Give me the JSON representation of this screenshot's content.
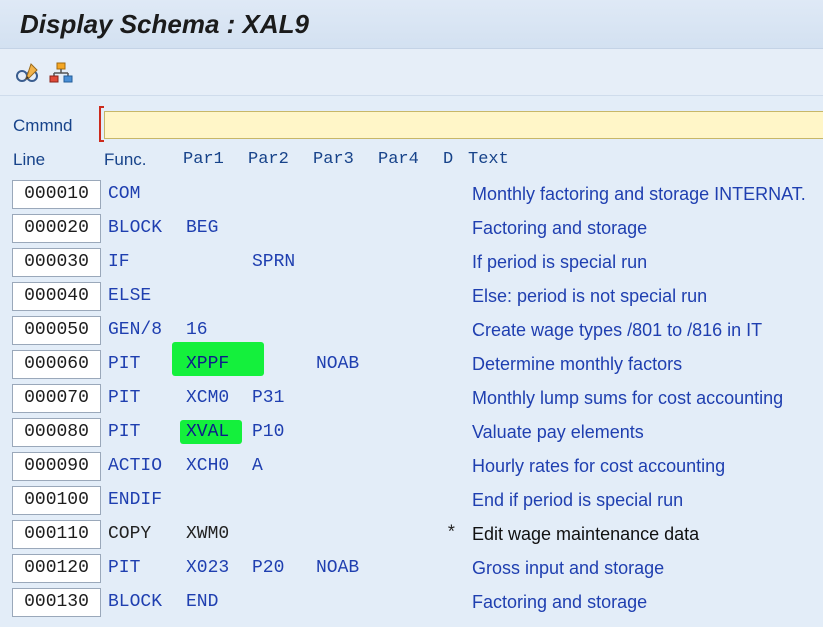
{
  "window": {
    "title": "Display Schema : XAL9"
  },
  "toolbar": {
    "icons": [
      "display-change-icon",
      "hierarchy-icon"
    ]
  },
  "command": {
    "label": "Cmmnd",
    "value": ""
  },
  "columns": {
    "line": "Line",
    "func": "Func.",
    "par1": "Par1",
    "par2": "Par2",
    "par3": "Par3",
    "par4": "Par4",
    "d": "D",
    "text": "Text"
  },
  "highlight_color": "#14f03c",
  "rows": [
    {
      "line": "000010",
      "func": "COM",
      "par1": "",
      "par2": "",
      "par3": "",
      "par4": "",
      "d": "",
      "text": "Monthly factoring and storage INTERNAT."
    },
    {
      "line": "000020",
      "func": "BLOCK",
      "par1": "BEG",
      "par2": "",
      "par3": "",
      "par4": "",
      "d": "",
      "text": "Factoring and storage"
    },
    {
      "line": "000030",
      "func": "IF",
      "par1": "",
      "par2": "SPRN",
      "par3": "",
      "par4": "",
      "d": "",
      "text": "If period is special run"
    },
    {
      "line": "000040",
      "func": "ELSE",
      "par1": "",
      "par2": "",
      "par3": "",
      "par4": "",
      "d": "",
      "text": "Else: period is not special run"
    },
    {
      "line": "000050",
      "func": "GEN/8",
      "par1": "16",
      "par2": "",
      "par3": "",
      "par4": "",
      "d": "",
      "text": "Create wage types /801 to /816 in IT"
    },
    {
      "line": "000060",
      "func": "PIT",
      "par1": "XPPF",
      "par2": "",
      "par3": "NOAB",
      "par4": "",
      "d": "",
      "text": "Determine monthly factors"
    },
    {
      "line": "000070",
      "func": "PIT",
      "par1": "XCM0",
      "par2": "P31",
      "par3": "",
      "par4": "",
      "d": "",
      "text": "Monthly lump sums for cost accounting"
    },
    {
      "line": "000080",
      "func": "PIT",
      "par1": "XVAL",
      "par2": "P10",
      "par3": "",
      "par4": "",
      "d": "",
      "text": "Valuate pay elements"
    },
    {
      "line": "000090",
      "func": "ACTIO",
      "par1": "XCH0",
      "par2": "A",
      "par3": "",
      "par4": "",
      "d": "",
      "text": "Hourly rates for cost accounting"
    },
    {
      "line": "000100",
      "func": "ENDIF",
      "par1": "",
      "par2": "",
      "par3": "",
      "par4": "",
      "d": "",
      "text": "End if period is special run"
    },
    {
      "line": "000110",
      "func": "COPY",
      "par1": "XWM0",
      "par2": "",
      "par3": "",
      "par4": "",
      "d": "*",
      "text": "Edit wage maintenance data"
    },
    {
      "line": "000120",
      "func": "PIT",
      "par1": "X023",
      "par2": "P20",
      "par3": "NOAB",
      "par4": "",
      "d": "",
      "text": "Gross input and storage"
    },
    {
      "line": "000130",
      "func": "BLOCK",
      "par1": "END",
      "par2": "",
      "par3": "",
      "par4": "",
      "d": "",
      "text": "Factoring and storage"
    }
  ]
}
